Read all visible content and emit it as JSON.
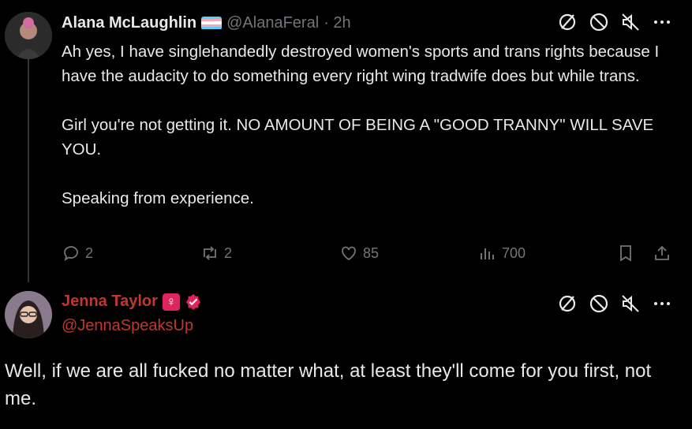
{
  "tweet1": {
    "name": "Alana McLaughlin",
    "handle": "@AlanaFeral",
    "time": "· 2h",
    "paragraphs": [
      "Ah yes, I have singlehandedly destroyed women's sports and trans rights because I have the audacity to do something every right wing tradwife does but while trans.",
      "Girl you're not getting it. NO AMOUNT OF BEING A \"GOOD TRANNY\" WILL SAVE YOU.",
      "Speaking from experience."
    ],
    "replies": "2",
    "reposts": "2",
    "likes": "85",
    "views": "700"
  },
  "tweet2": {
    "name": "Jenna Taylor",
    "female_badge": "♀",
    "handle": "@JennaSpeaksUp",
    "text": "Well, if we are all fucked no matter what, at least they'll come for you first, not me."
  },
  "colors": {
    "background": "#000000",
    "text": "#e7e9ea",
    "muted": "#71767b",
    "name_red": "#c0392b"
  },
  "icons": [
    "block-icon",
    "mute-icon",
    "more-icon",
    "reply-icon",
    "repost-icon",
    "like-icon",
    "views-icon",
    "bookmark-icon",
    "share-icon"
  ]
}
